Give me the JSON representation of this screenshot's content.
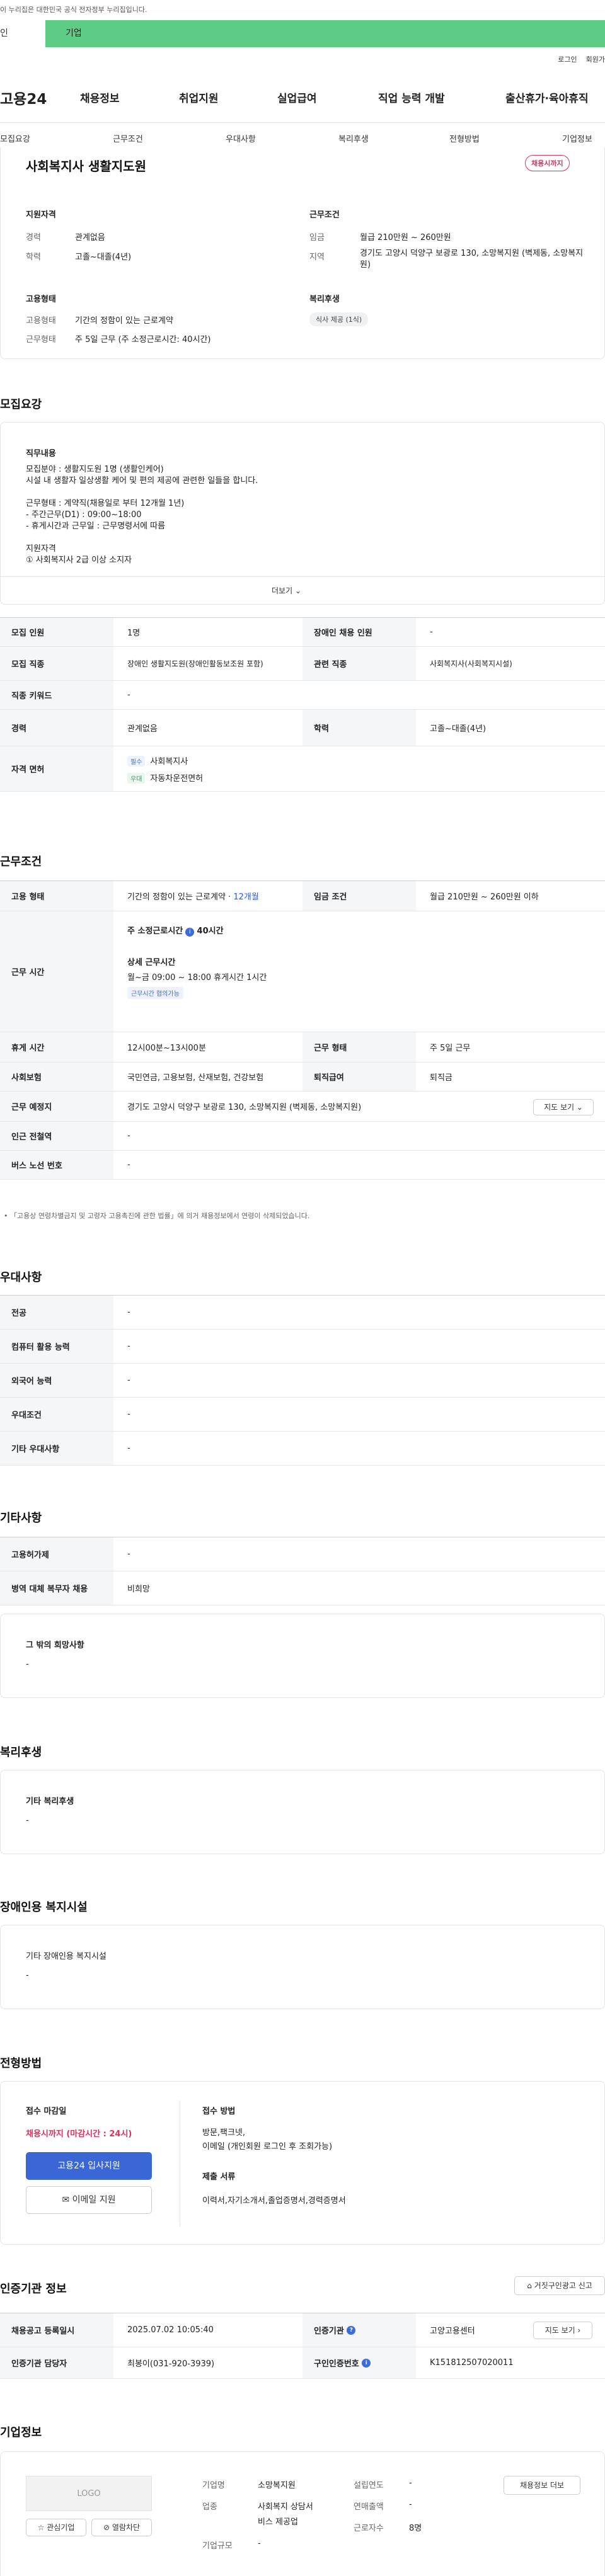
{
  "gov_notice": "이 누리집은 대한민국 공식 전자정부 누리집입니다.",
  "user_tabs": [
    "인",
    "기업"
  ],
  "util": [
    "로그인",
    "회원가"
  ],
  "gnb": {
    "logo": "고용24",
    "menu": [
      "채용정보",
      "취업지원",
      "실업급여",
      "직업 능력 개발",
      "출산휴가·육아휴직"
    ]
  },
  "subnav": [
    "모집요강",
    "근무조건",
    "우대사항",
    "복리후생",
    "전형방법",
    "기업정보"
  ],
  "summary": {
    "title": "사회복지사 생활지도원",
    "badge": "채용시까지",
    "qual_title": "지원자격",
    "career_label": "경력",
    "career": "관계없음",
    "edu_label": "학력",
    "edu": "고졸~대졸(4년)",
    "cond_title": "근무조건",
    "wage_label": "임금",
    "wage": "월급 210만원 ~ 260만원",
    "region_label": "지역",
    "region": "경기도 고양시 덕양구 보광로 130, 소망복지원 (벽제동, 소망복지원)",
    "emp_title": "고용형태",
    "emptype_label": "고용형태",
    "emptype": "기간의 정함이 있는 근로계약",
    "worktype_label": "근무형태",
    "worktype": "주 5일 근무 (주 소정근로시간: 40시간)",
    "welfare_title": "복리후생",
    "welfare_pill": "식사 제공 (1식)"
  },
  "recruit": {
    "title": "모집요강",
    "job_head": "직무내용",
    "job_lines": [
      "모집분야 : 생활지도원 1명 (생활인케어)",
      "시설 내 생활자 일상생활 케어 및 편의 제공에 관련한 일들을 합니다.",
      "",
      "근무형태 : 계약직(채용일로 부터 12개월 1년)",
      "- 주간근무(D1) : 09:00~18:00",
      "- 휴게시간과 근무일 : 근무명령서에 따름",
      "",
      "지원자격",
      "① 사회복지사 2급 이상 소지자"
    ],
    "more": "더보기",
    "rows": [
      {
        "k1": "모집 인원",
        "v1": "1명",
        "k2": "장애인 채용 인원",
        "v2": "-"
      },
      {
        "k1": "모집 직종",
        "v1": "장애인 생활지도원(장애인활동보조원 포함)",
        "k2": "관련 직종",
        "v2": "사회복지사(사회복지시설)"
      },
      {
        "k1": "직종 키워드",
        "v1": "-"
      },
      {
        "k1": "경력",
        "v1": "관계없음",
        "k2": "학력",
        "v2": "고졸~대졸(4년)"
      }
    ],
    "license_label": "자격 면허",
    "licenses": [
      {
        "tag": "필수",
        "name": "사회복지사"
      },
      {
        "tag": "우대",
        "name": "자동차운전면허"
      }
    ]
  },
  "conditions": {
    "title": "근무조건",
    "emp_label": "고용 형태",
    "emp": "기간의 정함이 있는 근로계약 · ",
    "emp_term": "12개월",
    "wage_label": "임금 조건",
    "wage": "월급 210만원 ~ 260만원 이하",
    "hours_label": "근무 시간",
    "weekly": "주 소정근로시간",
    "weekly_val": "40시간",
    "detail": "상세 근무시간",
    "detail_val": "월~금 09:00 ~ 18:00  휴게시간 1시간",
    "flex": "근무시간 협의가능",
    "break_label": "휴게 시간",
    "break": "12시00분~13시00분",
    "shift_label": "근무 형태",
    "shift": "주 5일 근무",
    "ins_label": "사회보험",
    "ins": "국민연금, 고용보험, 산재보험, 건강보험",
    "sev_label": "퇴직급여",
    "sev": "퇴직금",
    "place_label": "근무 예정지",
    "place": "경기도 고양시 덕양구 보광로 130, 소망복지원 (벽제동, 소망복지원)",
    "map": "지도 보기",
    "subway_label": "인근 전철역",
    "subway": "-",
    "bus_label": "버스 노선 번호",
    "bus": "-",
    "note": "「고용상 연령차별금지 및 고령자 고용촉진에 관한 법률」에 의거 채용정보에서 연령이 삭제되었습니다."
  },
  "prefer": {
    "title": "우대사항",
    "rows": [
      {
        "k": "전공",
        "v": "-"
      },
      {
        "k": "컴퓨터 활용 능력",
        "v": "-"
      },
      {
        "k": "외국어 능력",
        "v": "-"
      },
      {
        "k": "우대조건",
        "v": "-"
      },
      {
        "k": "기타 우대사항",
        "v": "-"
      }
    ]
  },
  "etc": {
    "title": "기타사항",
    "rows": [
      {
        "k": "고용허가제",
        "v": "-"
      },
      {
        "k": "병역 대체 복무자 채용",
        "v": "비희망"
      }
    ],
    "other_head": "그 밖의 희망사항",
    "other": "-"
  },
  "welfare": {
    "title": "복리후생",
    "head": "기타 복리후생",
    "val": "-"
  },
  "disability": {
    "title": "장애인용 복지시설",
    "head": "기타 장애인용 복지시설",
    "val": "-"
  },
  "apply": {
    "title": "전형방법",
    "deadline_head": "접수 마감일",
    "deadline": "채용시까지 (마감시간 : 24시)",
    "apply_btn": "고용24 입사지원",
    "email_btn": "이메일 지원",
    "method_head": "접수 방법",
    "method": "방문,팩크넷,",
    "method2": "이메일 (개인회원 로그인 후 조회가능)",
    "docs_head": "제출 서류",
    "docs": "이력서,자기소개서,졸업증명서,경력증명서"
  },
  "auth": {
    "title": "인증기관 정보",
    "report_btn": "거짓구인광고 신고",
    "reg_label": "채용공고 등록일시",
    "reg": "2025.07.02 10:05:40",
    "org_label": "인증기관",
    "org": "고양고용센터",
    "map": "지도 보기",
    "mgr_label": "인증기관 담당자",
    "mgr": "최봉이(031-920-3939)",
    "no_label": "구인인증번호",
    "no": "K151812507020011"
  },
  "company": {
    "title": "기업정보",
    "logo": "LOGO",
    "fav": "관심기업",
    "block": "열람차단",
    "list_btn": "채용정보 더보",
    "name_label": "기업명",
    "name": "소망복지원",
    "ind_label": "업종",
    "ind": "사회복지 상담서",
    "ind2": "비스 제공업",
    "size_label": "기업규모",
    "size": "-",
    "year_label": "설립연도",
    "year": "-",
    "sales_label": "연매출액",
    "sales": "-",
    "emp_label": "근로자수",
    "emp": "8명"
  }
}
